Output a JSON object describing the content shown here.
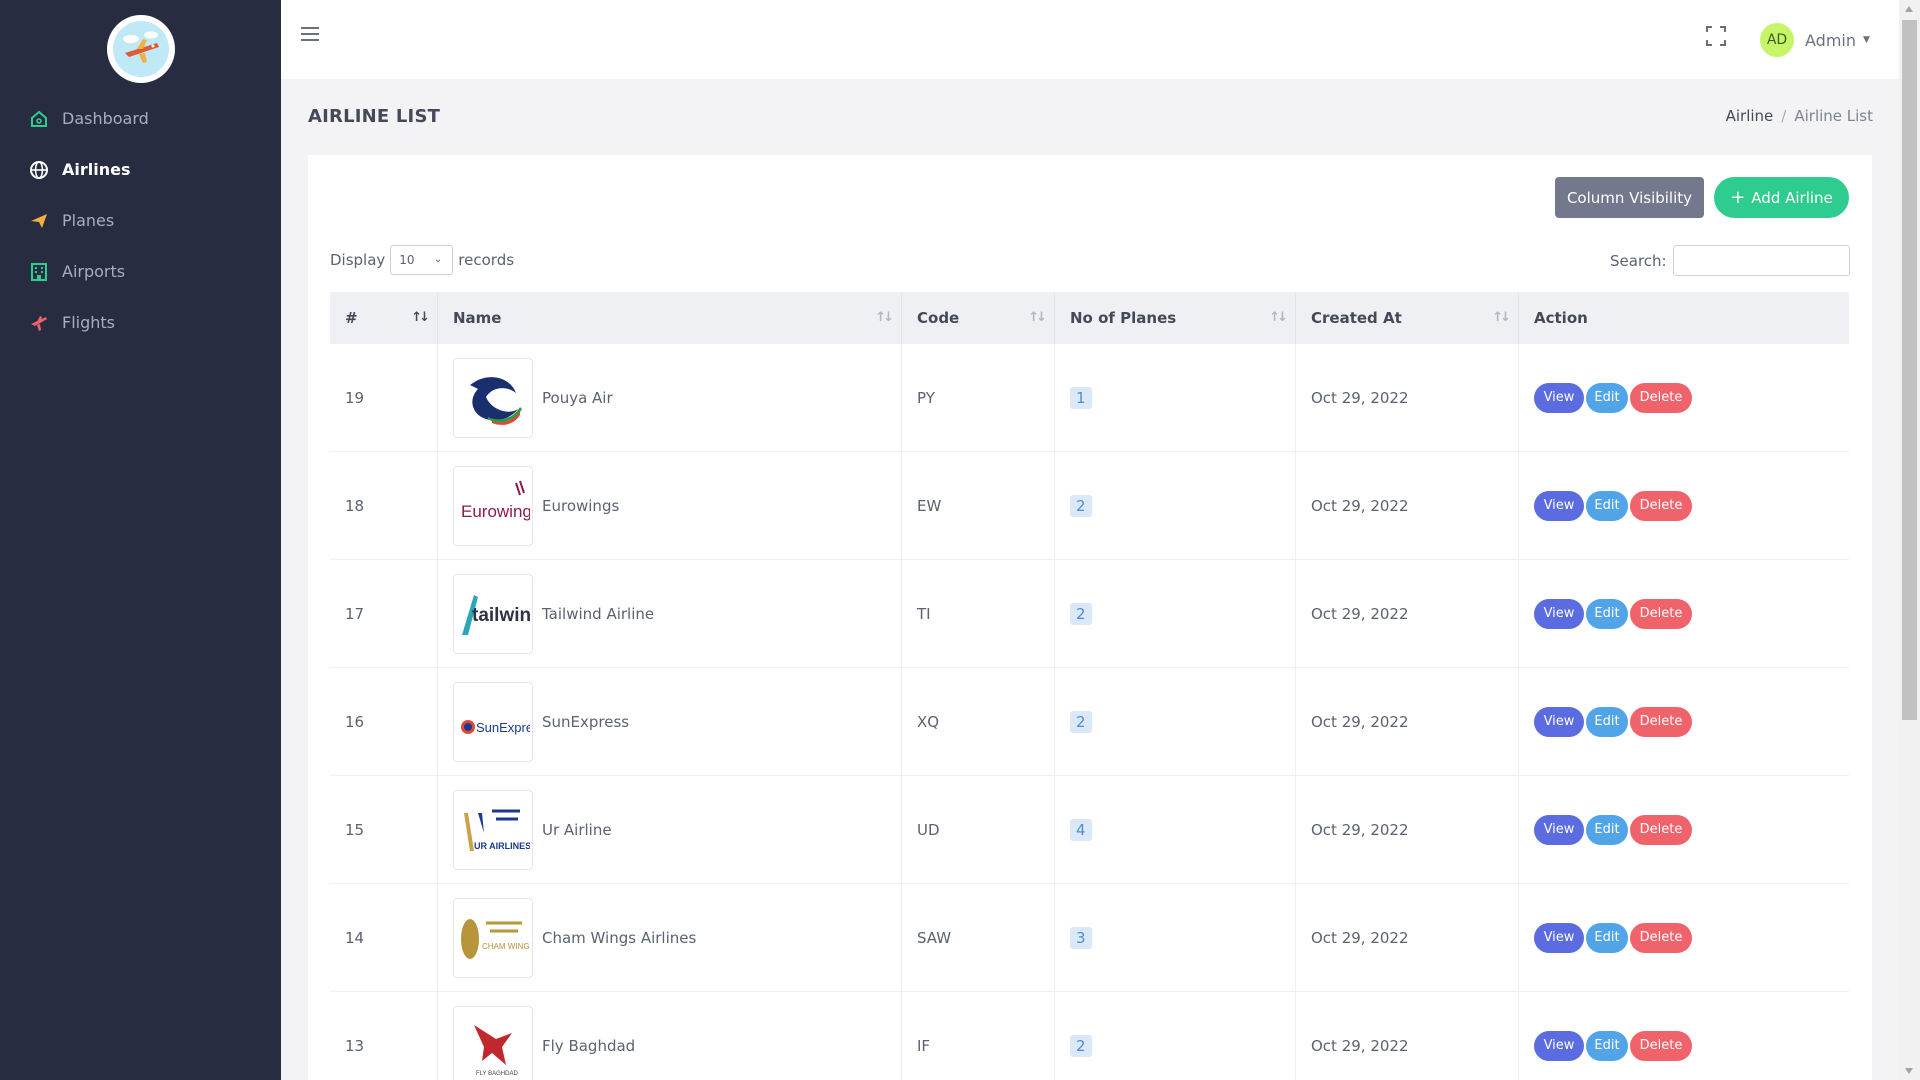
{
  "sidebar": {
    "items": [
      {
        "label": "Dashboard",
        "icon": "home-icon",
        "color": "#2ecc8e"
      },
      {
        "label": "Airlines",
        "icon": "globe-icon",
        "color": "#ffffff"
      },
      {
        "label": "Planes",
        "icon": "paper-plane-icon",
        "color": "#f5b041"
      },
      {
        "label": "Airports",
        "icon": "building-icon",
        "color": "#2ecc8e"
      },
      {
        "label": "Flights",
        "icon": "airplane-icon",
        "color": "#f1636b"
      }
    ]
  },
  "topbar": {
    "avatar_initials": "AD",
    "user_name": "Admin"
  },
  "page": {
    "title": "AIRLINE LIST",
    "breadcrumb": [
      "Airline",
      "/",
      "Airline List"
    ]
  },
  "toolbar": {
    "column_visibility": "Column Visibility",
    "add_airline": "Add Airline",
    "display_label": "Display",
    "display_value": "10",
    "records_label": "records",
    "search_label": "Search:"
  },
  "table": {
    "headers": [
      "#",
      "Name",
      "Code",
      "No of Planes",
      "Created At",
      "Action"
    ],
    "rows": [
      {
        "id": "19",
        "name": "Pouya Air",
        "code": "PY",
        "planes": "1",
        "created": "Oct 29, 2022"
      },
      {
        "id": "18",
        "name": "Eurowings",
        "code": "EW",
        "planes": "2",
        "created": "Oct 29, 2022"
      },
      {
        "id": "17",
        "name": "Tailwind Airline",
        "code": "TI",
        "planes": "2",
        "created": "Oct 29, 2022"
      },
      {
        "id": "16",
        "name": "SunExpress",
        "code": "XQ",
        "planes": "2",
        "created": "Oct 29, 2022"
      },
      {
        "id": "15",
        "name": "Ur Airline",
        "code": "UD",
        "planes": "4",
        "created": "Oct 29, 2022"
      },
      {
        "id": "14",
        "name": "Cham Wings Airlines",
        "code": "SAW",
        "planes": "3",
        "created": "Oct 29, 2022"
      },
      {
        "id": "13",
        "name": "Fly Baghdad",
        "code": "IF",
        "planes": "2",
        "created": "Oct 29, 2022"
      }
    ],
    "actions": {
      "view": "View",
      "edit": "Edit",
      "delete": "Delete"
    },
    "logo_texts": {
      "eurowings": "Eurowings",
      "tailwind": "tailwind",
      "sunexpress": "SunExpress",
      "ur": "UR AIRLINES",
      "cham": "CHAM WINGS",
      "flybaghdad": "FLY BAGHDAD"
    }
  }
}
